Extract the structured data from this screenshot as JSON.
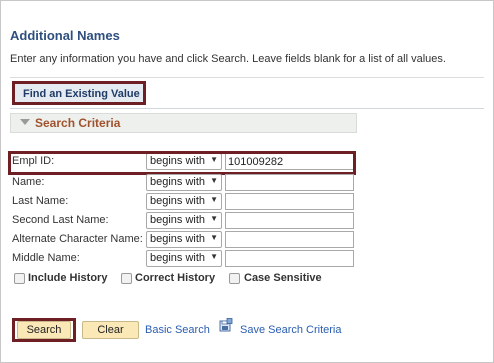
{
  "page": {
    "title": "Additional Names",
    "instructions": "Enter any information you have and click Search. Leave fields blank for a list of all values."
  },
  "tab": {
    "label": "Find an Existing Value"
  },
  "criteria": {
    "label": "Search Criteria",
    "icon": "collapse-triangle-icon"
  },
  "fields": [
    {
      "label": "Empl ID:",
      "operator": "begins with",
      "value": "101009282"
    },
    {
      "label": "Name:",
      "operator": "begins with",
      "value": ""
    },
    {
      "label": "Last Name:",
      "operator": "begins with",
      "value": ""
    },
    {
      "label": "Second Last Name:",
      "operator": "begins with",
      "value": ""
    },
    {
      "label": "Alternate Character Name:",
      "operator": "begins with",
      "value": ""
    },
    {
      "label": "Middle Name:",
      "operator": "begins with",
      "value": ""
    }
  ],
  "options": {
    "include_history": "Include History",
    "correct_history": "Correct History",
    "case_sensitive": "Case Sensitive"
  },
  "actions": {
    "search": "Search",
    "clear": "Clear",
    "basic_search": "Basic Search",
    "save_search": "Save Search Criteria",
    "save_icon": "save-search-icon"
  },
  "colors": {
    "highlight_border": "#6d1f24",
    "title": "#2e4f7f",
    "criteria_label": "#a0522d",
    "link": "#2a5db0",
    "button_bg": "#fbe8b7"
  }
}
